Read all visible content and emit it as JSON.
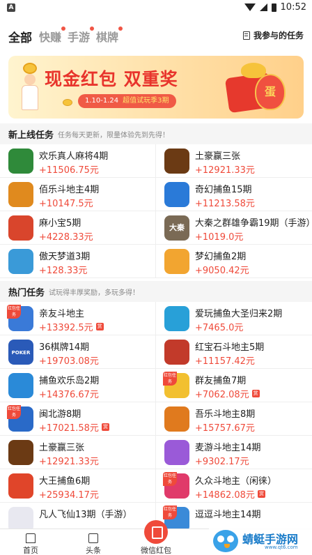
{
  "status_bar": {
    "time": "10:52",
    "app_badge": "A"
  },
  "tabs": [
    {
      "label": "全部",
      "active": true
    },
    {
      "label": "快赚",
      "dot": true
    },
    {
      "label": "手游",
      "dot": true
    },
    {
      "label": "棋牌",
      "dot": true
    }
  ],
  "my_tasks_label": "我参与的任务",
  "banner": {
    "title": "现金红包 双重奖",
    "date": "1.10-1.24",
    "highlight": "超值试玩季3期",
    "egg_char": "蛋"
  },
  "new_section": {
    "title": "新上线任务",
    "subtitle": "任务每天更新，限量体验先到先得！",
    "items": [
      {
        "name": "欢乐真人麻将4期",
        "reward": "+11506.75元",
        "icon_name": "mahjong-game-icon",
        "icon_color": "#2f8a3a"
      },
      {
        "name": "土豪赢三张",
        "reward": "+12921.33元",
        "icon_name": "poker-game-icon",
        "icon_color": "#6b3a14"
      },
      {
        "name": "佰乐斗地主4期",
        "reward": "+10147.5元",
        "icon_name": "landlord-game-icon",
        "icon_color": "#e08a1e"
      },
      {
        "name": "奇幻捕鱼15期",
        "reward": "+11213.58元",
        "icon_name": "fishing-game-icon",
        "icon_color": "#2a7ad8"
      },
      {
        "name": "麻小宝5期",
        "reward": "+4228.33元",
        "icon_name": "mahjong-kid-icon",
        "icon_color": "#d9452c"
      },
      {
        "name": "大秦之群雄争霸19期（手游）",
        "reward": "+1019.0元",
        "icon_name": "war-game-icon",
        "icon_color": "#7a6a55",
        "icon_text": "大秦"
      },
      {
        "name": "傲天梦道3期",
        "reward": "+128.33元",
        "icon_name": "fantasy-game-icon",
        "icon_color": "#3a9ad8"
      },
      {
        "name": "梦幻捕鱼2期",
        "reward": "+9050.42元",
        "icon_name": "fish-game-icon",
        "icon_color": "#f2a530"
      }
    ]
  },
  "hot_section": {
    "title": "热门任务",
    "subtitle": "试玩得丰厚奖励，多玩多得！",
    "corner_text": "红包任务",
    "tag_text": "赏",
    "items": [
      {
        "name": "亲友斗地主",
        "reward": "+13392.5元",
        "icon_name": "landlord-friends-icon",
        "icon_color": "#3a7ad8",
        "corner": true,
        "tag": true
      },
      {
        "name": "爱玩捕鱼大圣归来2期",
        "reward": "+7465.0元",
        "icon_name": "monkey-fish-icon",
        "icon_color": "#28a0d8"
      },
      {
        "name": "36棋牌14期",
        "reward": "+19703.08元",
        "icon_name": "poker-36-icon",
        "icon_color": "#2a5ab8",
        "icon_text": "POKER"
      },
      {
        "name": "红宝石斗地主5期",
        "reward": "+11157.42元",
        "icon_name": "ruby-landlord-icon",
        "icon_color": "#c23a2a"
      },
      {
        "name": "捕鱼欢乐岛2期",
        "reward": "+14376.67元",
        "icon_name": "fish-island-icon",
        "icon_color": "#2a8ad8"
      },
      {
        "name": "群友捕鱼7期",
        "reward": "+7062.08元",
        "icon_name": "group-fish-icon",
        "icon_color": "#f2c030",
        "corner": true,
        "tag": true
      },
      {
        "name": "闽北游8期",
        "reward": "+17021.58元",
        "icon_name": "minbei-game-icon",
        "icon_color": "#2a6ac8",
        "corner": true,
        "tag": true
      },
      {
        "name": "吾乐斗地主8期",
        "reward": "+15757.67元",
        "icon_name": "wule-landlord-icon",
        "icon_color": "#e07a1e"
      },
      {
        "name": "土豪赢三张",
        "reward": "+12921.33元",
        "icon_name": "poker-game-icon",
        "icon_color": "#6b3a14"
      },
      {
        "name": "麦游斗地主14期",
        "reward": "+9302.17元",
        "icon_name": "maiyou-landlord-icon",
        "icon_color": "#9a5ad8"
      },
      {
        "name": "大王捕鱼6期",
        "reward": "+25934.17元",
        "icon_name": "king-fish-icon",
        "icon_color": "#e0452a"
      },
      {
        "name": "久众斗地主（闲徕）",
        "reward": "+14862.08元",
        "icon_name": "jiuzhong-landlord-icon",
        "icon_color": "#e03a6a",
        "corner": true,
        "tag": true
      },
      {
        "name": "凡人飞仙13期（手游）",
        "reward": "",
        "icon_name": "immortal-game-icon",
        "icon_color": "#e8e8f0"
      },
      {
        "name": "逗逗斗地主14期",
        "reward": "",
        "icon_name": "doudou-landlord-icon",
        "icon_color": "#3a8ad8",
        "corner": true
      }
    ]
  },
  "bottom_nav": [
    {
      "label": "首页",
      "icon_name": "home-icon"
    },
    {
      "label": "头条",
      "icon_name": "news-icon"
    },
    {
      "label": "微信红包",
      "icon_name": "red-envelope-icon"
    }
  ],
  "watermark": {
    "text": "蜻蜓手游网",
    "url": "www.qt6.com"
  }
}
